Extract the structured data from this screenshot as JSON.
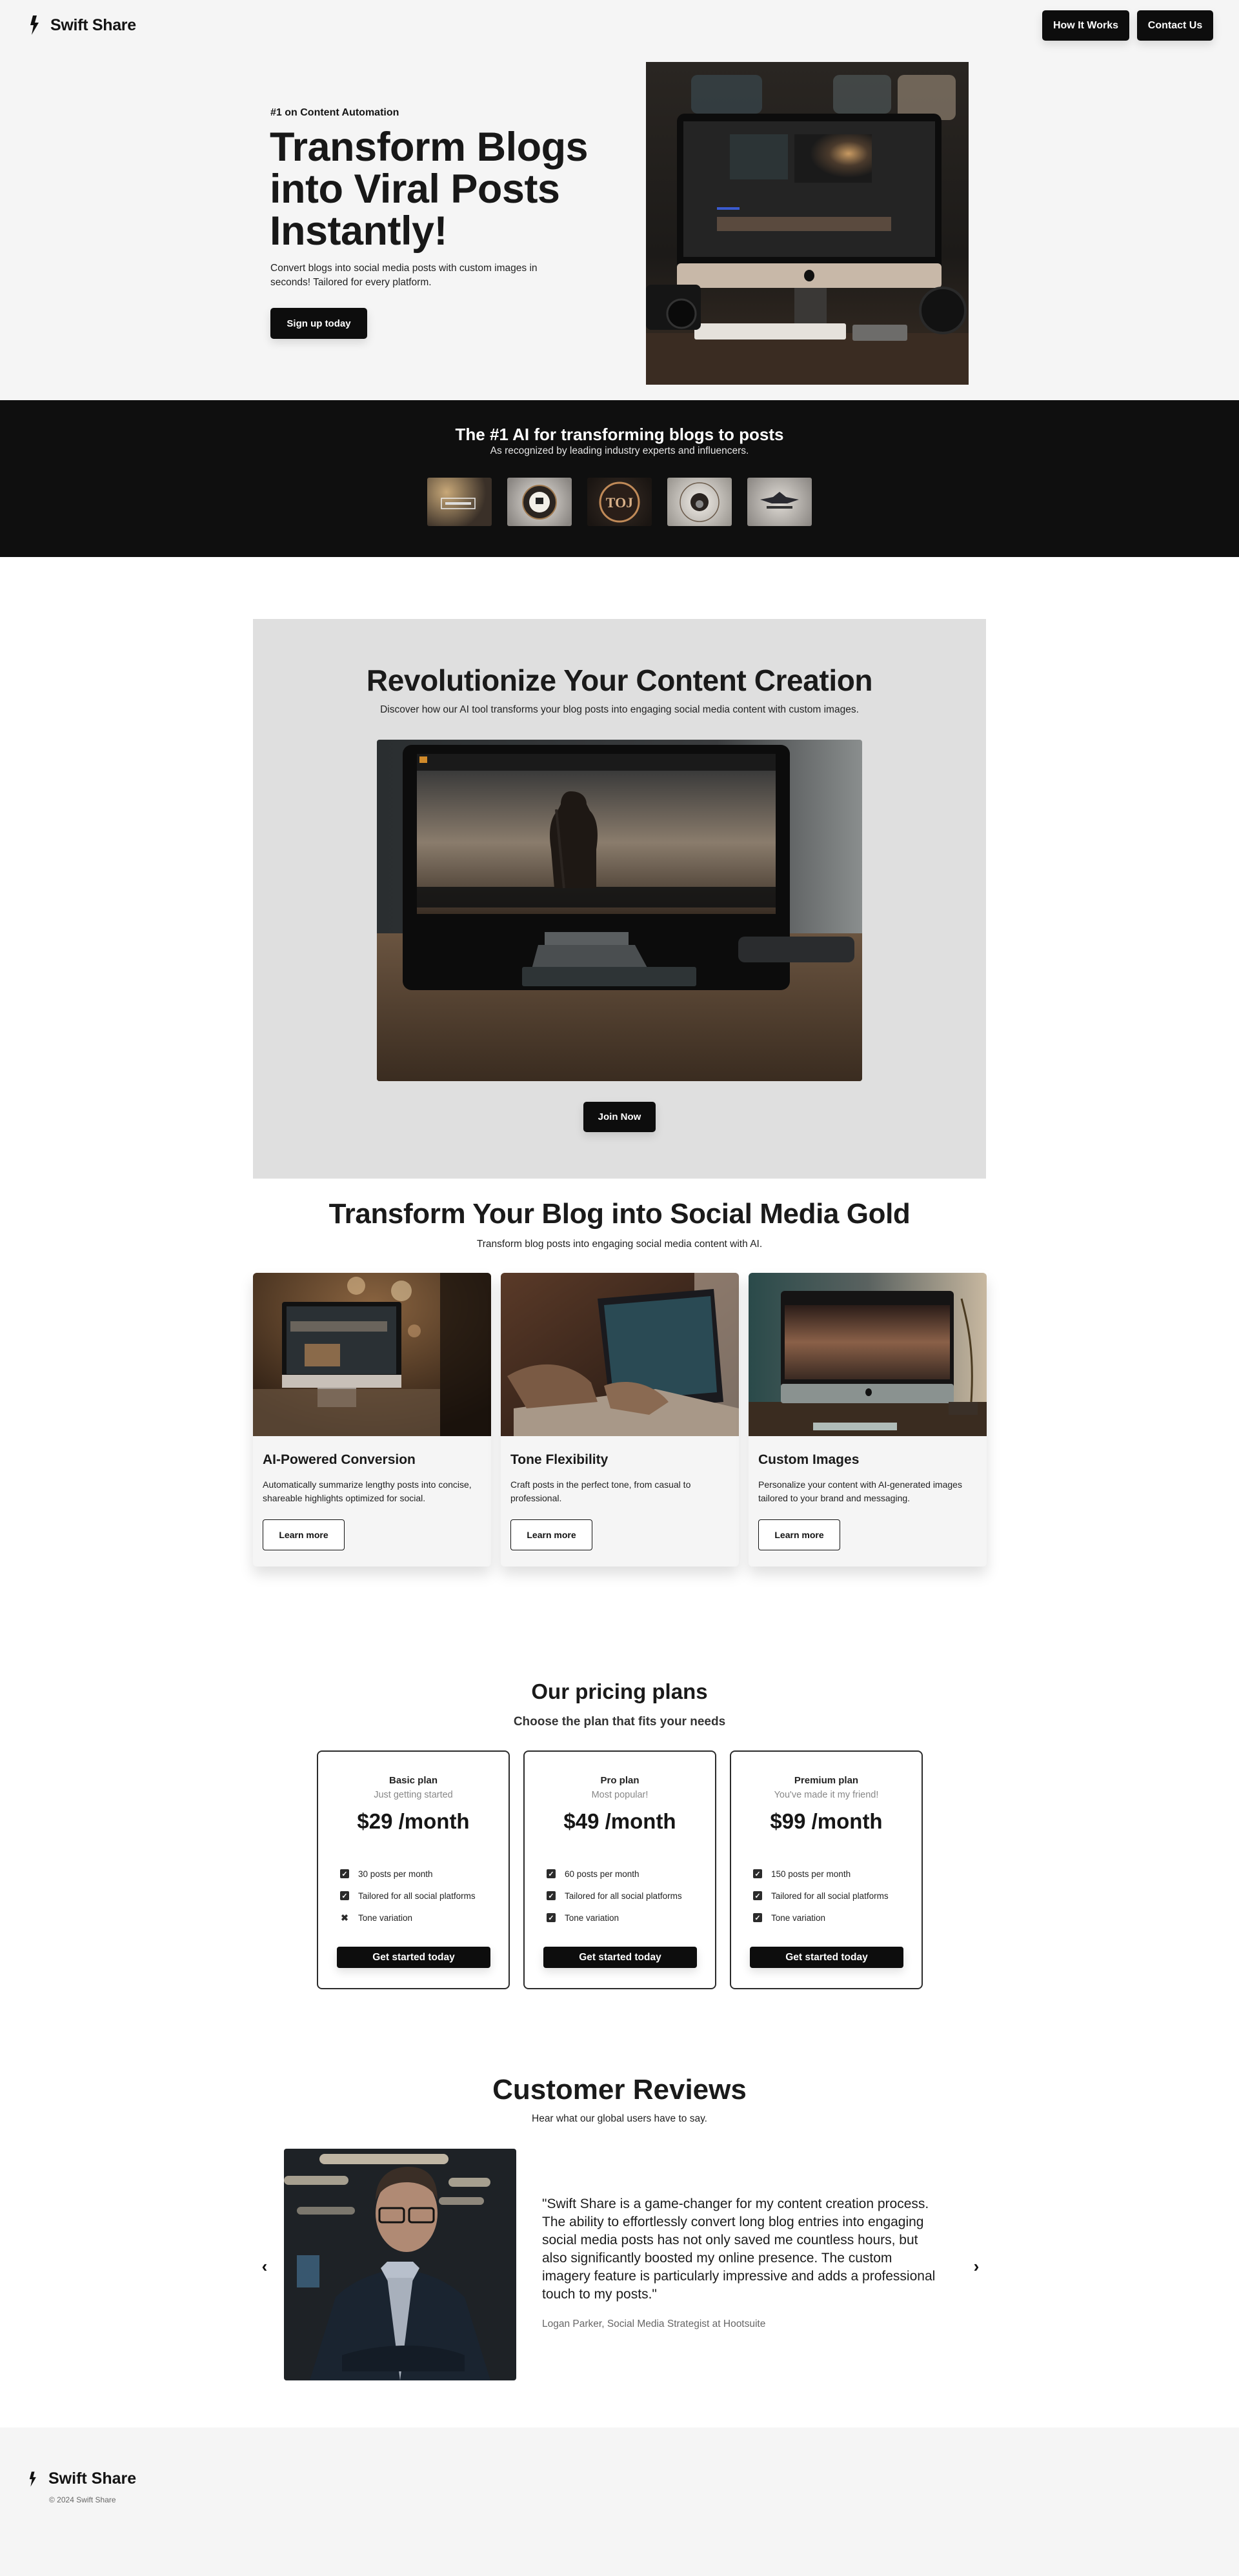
{
  "header": {
    "brand": "Swift Share",
    "nav": [
      {
        "label": "How It Works"
      },
      {
        "label": "Contact Us"
      }
    ]
  },
  "hero": {
    "tagline": "#1 on Content Automation",
    "title": "Transform Blogs into Viral Posts Instantly!",
    "description": "Convert blogs into social media posts with custom images in seconds! Tailored for every platform.",
    "cta": "Sign up today",
    "image_alt": "iMac on desk showing video editing software with camera and keyboard"
  },
  "recognition": {
    "title": "The #1 AI for transforming blogs to posts",
    "subtitle": "As recognized by leading industry experts and influencers.",
    "logos": [
      {
        "alt": "Cinematic badge logo"
      },
      {
        "alt": "Camera emblem logo"
      },
      {
        "alt": "TOJ bronze emblem logo"
      },
      {
        "alt": "Camera crest logo"
      },
      {
        "alt": "Winged emblem logo"
      }
    ]
  },
  "revolutionize": {
    "title": "Revolutionize Your Content Creation",
    "subtitle": "Discover how our AI tool transforms your blog posts into engaging social media content with custom images.",
    "image_alt": "Monitor displaying cinematic scene of a soldier",
    "cta": "Join Now"
  },
  "features": {
    "title": "Transform Your Blog into Social Media Gold",
    "subtitle": "Transform blog posts into engaging social media content with AI.",
    "cards": [
      {
        "title": "AI-Powered Conversion",
        "description": "Automatically summarize lengthy posts into concise, shareable highlights optimized for social.",
        "cta": "Learn more"
      },
      {
        "title": "Tone Flexibility",
        "description": "Craft posts in the perfect tone, from casual to professional.",
        "cta": "Learn more"
      },
      {
        "title": "Custom Images",
        "description": "Personalize your content with AI-generated images tailored to your brand and messaging.",
        "cta": "Learn more"
      }
    ]
  },
  "pricing": {
    "title": "Our pricing plans",
    "subtitle": "Choose the plan that fits your needs",
    "plans": [
      {
        "name": "Basic plan",
        "tagline": "Just getting started",
        "price": "$29 /month",
        "features": [
          {
            "label": "30 posts per month",
            "included": true
          },
          {
            "label": "Tailored for all social platforms",
            "included": true
          },
          {
            "label": "Tone variation",
            "included": false
          }
        ],
        "cta": "Get started today"
      },
      {
        "name": "Pro plan",
        "tagline": "Most popular!",
        "price": "$49 /month",
        "features": [
          {
            "label": "60 posts per month",
            "included": true
          },
          {
            "label": "Tailored for all social platforms",
            "included": true
          },
          {
            "label": "Tone variation",
            "included": true
          }
        ],
        "cta": "Get started today"
      },
      {
        "name": "Premium plan",
        "tagline": "You've made it my friend!",
        "price": "$99 /month",
        "features": [
          {
            "label": "150 posts per month",
            "included": true
          },
          {
            "label": "Tailored for all social platforms",
            "included": true
          },
          {
            "label": "Tone variation",
            "included": true
          }
        ],
        "cta": "Get started today"
      }
    ]
  },
  "reviews": {
    "title": "Customer Reviews",
    "subtitle": "Hear what our global users have to say.",
    "quote": "\"Swift Share is a game-changer for my content creation process. The ability to effortlessly convert long blog entries into engaging social media posts has not only saved me countless hours, but also significantly boosted my online presence. The custom imagery feature is particularly impressive and adds a professional touch to my posts.\"",
    "author": "Logan Parker, Social Media Strategist at Hootsuite",
    "prev_icon": "‹",
    "next_icon": "›"
  },
  "footer": {
    "brand": "Swift Share",
    "copyright": "© 2024 Swift Share"
  },
  "colors": {
    "primary_dark": "#0d0d0d",
    "page_bg_light": "#f5f5f5",
    "section_grey": "#dfdfdf"
  }
}
